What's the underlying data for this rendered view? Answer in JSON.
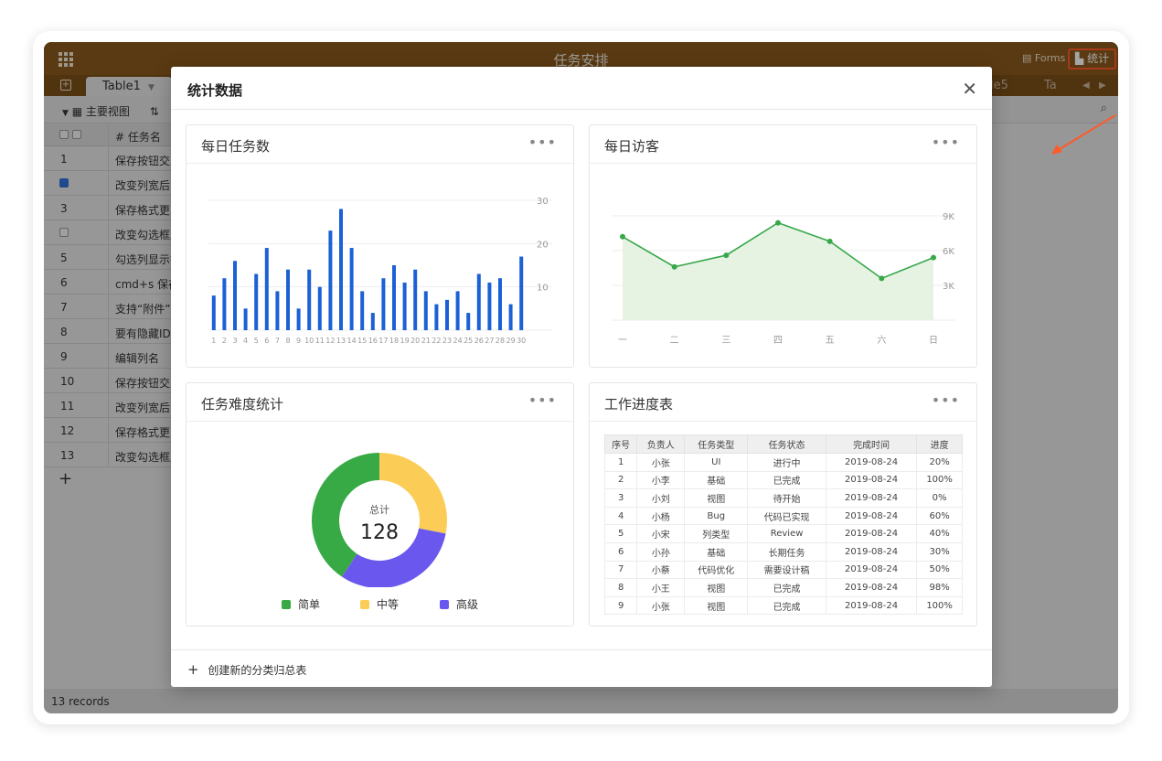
{
  "app": {
    "title": "任务安排",
    "forms_label": "Forms",
    "stats_label": "统计",
    "tabs": {
      "active": "Table1",
      "far1": "le5",
      "far2": "Ta"
    },
    "toolbar": {
      "view_label": "主要视图"
    },
    "table": {
      "header_name": "任务名",
      "rows": [
        {
          "num": "1",
          "name": "保存按钮交互",
          "checked": false
        },
        {
          "num": "",
          "name": "改变列宽后，",
          "checked": true
        },
        {
          "num": "3",
          "name": "保存格式更改",
          "checked": false
        },
        {
          "num": "",
          "name": "改变勾选框后",
          "checked": false
        },
        {
          "num": "5",
          "name": "勾选列显示行",
          "checked": false
        },
        {
          "num": "6",
          "name": "cmd+s 保存",
          "checked": false
        },
        {
          "num": "7",
          "name": "支持“附件”",
          "checked": false
        },
        {
          "num": "8",
          "name": "要有隐藏ID号",
          "checked": false
        },
        {
          "num": "9",
          "name": "编辑列名",
          "checked": false
        },
        {
          "num": "10",
          "name": "保存按钮交互",
          "checked": false
        },
        {
          "num": "11",
          "name": "改变列宽后，",
          "checked": false
        },
        {
          "num": "12",
          "name": "保存格式更改",
          "checked": false
        },
        {
          "num": "13",
          "name": "改变勾选框后",
          "checked": false
        }
      ]
    },
    "status": "13 records"
  },
  "modal": {
    "title": "统计数据",
    "footer_add": "创建新的分类归总表"
  },
  "cards": {
    "daily_tasks": "每日任务数",
    "daily_visitors": "每日访客",
    "difficulty": "任务难度统计",
    "progress": "工作进度表",
    "more": "•••"
  },
  "chart_data": [
    {
      "type": "bar",
      "categories": [
        "1",
        "2",
        "3",
        "4",
        "5",
        "6",
        "7",
        "8",
        "9",
        "10",
        "11",
        "12",
        "13",
        "14",
        "15",
        "16",
        "17",
        "18",
        "19",
        "20",
        "21",
        "22",
        "23",
        "24",
        "25",
        "26",
        "27",
        "28",
        "29",
        "30"
      ],
      "values": [
        8,
        12,
        16,
        5,
        13,
        19,
        9,
        14,
        5,
        14,
        10,
        23,
        28,
        19,
        9,
        4,
        12,
        15,
        11,
        14,
        9,
        6,
        7,
        9,
        4,
        13,
        11,
        12,
        6,
        17
      ],
      "yticks": [
        "10",
        "20",
        "30"
      ],
      "ylim": [
        0,
        30
      ],
      "color": "#1b60d6"
    },
    {
      "type": "area",
      "categories": [
        "一",
        "二",
        "三",
        "四",
        "五",
        "六",
        "日"
      ],
      "values": [
        7200,
        4600,
        5600,
        8400,
        6800,
        3600,
        5400
      ],
      "yticks": [
        "3K",
        "6K",
        "9K"
      ],
      "ylim": [
        0,
        9000
      ],
      "color": "#37a84a",
      "fill": "#e6f3e3"
    },
    {
      "type": "pie",
      "center_label": "总计",
      "center_value": "128",
      "slices": [
        {
          "name": "简单",
          "value": 52,
          "color": "#37aa46"
        },
        {
          "name": "中等",
          "value": 36,
          "color": "#fbcd57"
        },
        {
          "name": "高级",
          "value": 40,
          "color": "#6a58ee"
        }
      ]
    },
    {
      "type": "table",
      "columns": [
        "序号",
        "负责人",
        "任务类型",
        "任务状态",
        "完成时间",
        "进度"
      ],
      "rows": [
        [
          "1",
          "小张",
          "UI",
          "进行中",
          "2019-08-24",
          "20%"
        ],
        [
          "2",
          "小李",
          "基础",
          "已完成",
          "2019-08-24",
          "100%"
        ],
        [
          "3",
          "小刘",
          "视图",
          "待开始",
          "2019-08-24",
          "0%"
        ],
        [
          "4",
          "小杨",
          "Bug",
          "代码已实现",
          "2019-08-24",
          "60%"
        ],
        [
          "5",
          "小宋",
          "列类型",
          "Review",
          "2019-08-24",
          "40%"
        ],
        [
          "6",
          "小孙",
          "基础",
          "长期任务",
          "2019-08-24",
          "30%"
        ],
        [
          "7",
          "小蔡",
          "代码优化",
          "需要设计稿",
          "2019-08-24",
          "50%"
        ],
        [
          "8",
          "小王",
          "视图",
          "已完成",
          "2019-08-24",
          "98%"
        ],
        [
          "9",
          "小张",
          "视图",
          "已完成",
          "2019-08-24",
          "100%"
        ]
      ]
    }
  ]
}
